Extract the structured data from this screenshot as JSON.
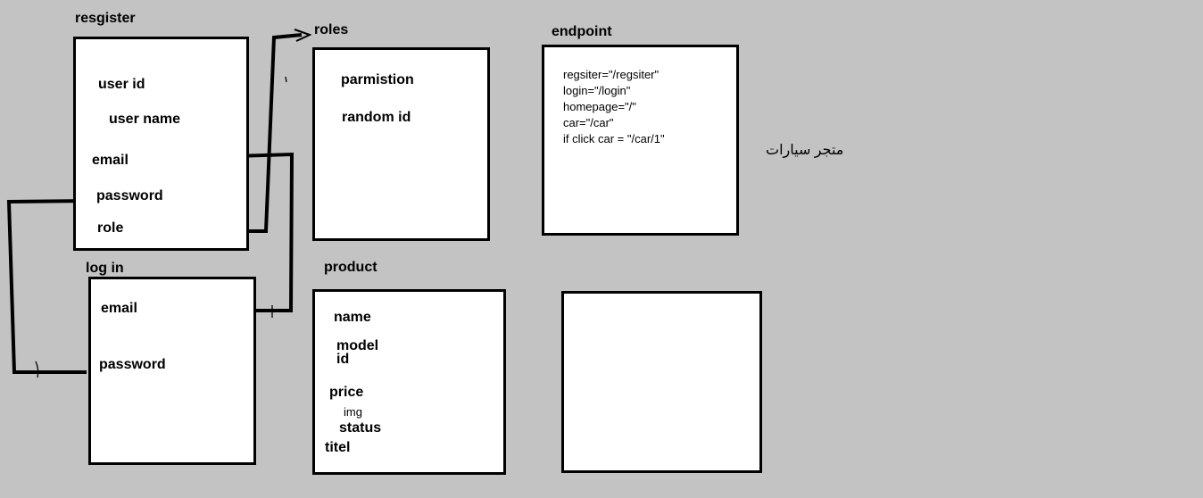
{
  "register": {
    "title": "resgister",
    "fields": [
      "user id",
      "user name",
      "email",
      "password",
      "role"
    ]
  },
  "roles": {
    "title": "roles",
    "fields": [
      "parmistion",
      "random id"
    ]
  },
  "endpoint": {
    "title": "endpoint",
    "lines": [
      "regsiter=\"/regsiter\"",
      "login=\"/login\"",
      "homepage=\"/\"",
      "car=\"/car\"",
      "if click car = \"/car/1\""
    ]
  },
  "login": {
    "title": "log in",
    "fields": [
      "email",
      "password"
    ]
  },
  "product": {
    "title": "product",
    "fields": [
      "name",
      "model",
      "id",
      "price",
      "img",
      "status",
      "titel"
    ]
  },
  "side_note": "متجر سيارات",
  "colors": {
    "background": "#c3c3c3",
    "box": "#ffffff",
    "ink": "#000000"
  }
}
